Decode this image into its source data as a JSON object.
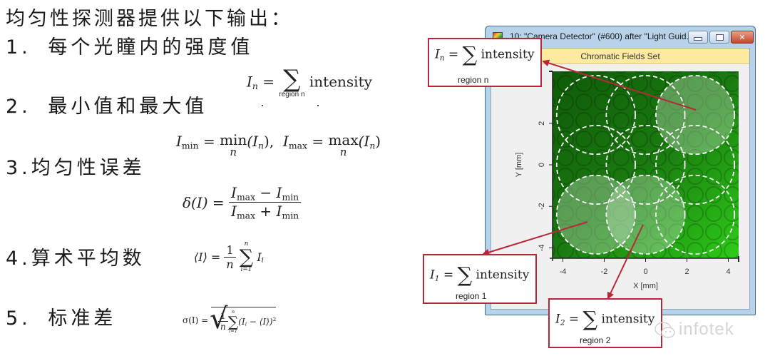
{
  "heading": "均匀性探测器提供以下输出：",
  "steps": [
    {
      "number": "1.",
      "label": "每个光瞳内的强度值"
    },
    {
      "number": "2.",
      "label": "最小值和最大值"
    },
    {
      "number": "3.",
      "label": "均匀性误差"
    },
    {
      "number": "4.",
      "label": "算术平均数"
    },
    {
      "number": "5.",
      "label": "标准差"
    }
  ],
  "formulas": {
    "intensity": {
      "lhs": "I",
      "lhs_sub": "n",
      "eq": "=",
      "sum_limit": "region n",
      "term": "intensity"
    },
    "minmax": {
      "min_lhs": "I",
      "min_sub": "min",
      "min_op": "min",
      "min_under": "n",
      "min_arg": "(I",
      "min_arg_sub": "n",
      "min_close": "),",
      "max_lhs": "I",
      "max_sub": "max",
      "max_op": "max",
      "max_under": "n",
      "max_arg": "(I",
      "max_arg_sub": "n",
      "max_close": ")"
    },
    "uniformity_error": {
      "lhs": "δ(I) =",
      "num_a": "I",
      "num_a_sub": "max",
      "num_op": " − ",
      "num_b": "I",
      "num_b_sub": "min",
      "den_a": "I",
      "den_a_sub": "max",
      "den_op": " + ",
      "den_b": "I",
      "den_b_sub": "min"
    },
    "mean": {
      "lhs": "⟨I⟩ =",
      "frac_num": "1",
      "frac_den": "n",
      "sum_top": "n",
      "sum_bottom": "i=1",
      "term": "I",
      "term_sub": "i"
    },
    "std_dev": {
      "lhs": "σ(I) =",
      "frac_num": "1",
      "frac_den": "n",
      "sum_top": "n",
      "sum_bottom": "i=1",
      "term": "(I",
      "term_sub": "i",
      "term_rest": " − ⟨I⟩)",
      "power": "2"
    }
  },
  "window": {
    "title": "10: \"Camera Detector\" (#600) after \"Light Guid...",
    "banner": "Chromatic Fields Set",
    "minimize_icon": "minimize-icon",
    "maximize_icon": "maximize-icon",
    "close_icon": "close-icon",
    "close_glyph": "✕"
  },
  "plot": {
    "x_label": "X [mm]",
    "y_label": "Y [mm]",
    "x_ticks": [
      "-4",
      "-2",
      "0",
      "2",
      "4"
    ],
    "y_ticks": [
      "2",
      "0",
      "-2",
      "-4"
    ],
    "x_range": [
      -4.5,
      4.5
    ],
    "y_range": [
      -4.5,
      4.5
    ],
    "regions": [
      {
        "cx": -2.4,
        "cy": 2.4,
        "highlighted": false
      },
      {
        "cx": 0.0,
        "cy": 2.4,
        "highlighted": false
      },
      {
        "cx": 2.4,
        "cy": 2.4,
        "highlighted": true
      },
      {
        "cx": -2.4,
        "cy": 0.0,
        "highlighted": false
      },
      {
        "cx": 0.0,
        "cy": 0.0,
        "highlighted": false
      },
      {
        "cx": 2.4,
        "cy": 0.0,
        "highlighted": false
      },
      {
        "cx": -2.4,
        "cy": -2.4,
        "highlighted": true
      },
      {
        "cx": 0.0,
        "cy": -2.4,
        "highlighted": true
      },
      {
        "cx": 2.4,
        "cy": -2.4,
        "highlighted": false
      }
    ],
    "region_radius": 1.9
  },
  "callouts": [
    {
      "id": "n",
      "lhs": "I",
      "lhs_sub": "n",
      "eq": "=",
      "term": "intensity",
      "region": "region n"
    },
    {
      "id": "1",
      "lhs": "I",
      "lhs_sub": "1",
      "eq": "=",
      "term": "intensity",
      "region": "region 1"
    },
    {
      "id": "2",
      "lhs": "I",
      "lhs_sub": "2",
      "eq": "=",
      "term": "intensity",
      "region": "region 2"
    }
  ],
  "colors": {
    "callout_border": "#b8283a",
    "arrow": "#b8283a",
    "plot_green": "#1f8a12"
  },
  "watermark": "infotek"
}
